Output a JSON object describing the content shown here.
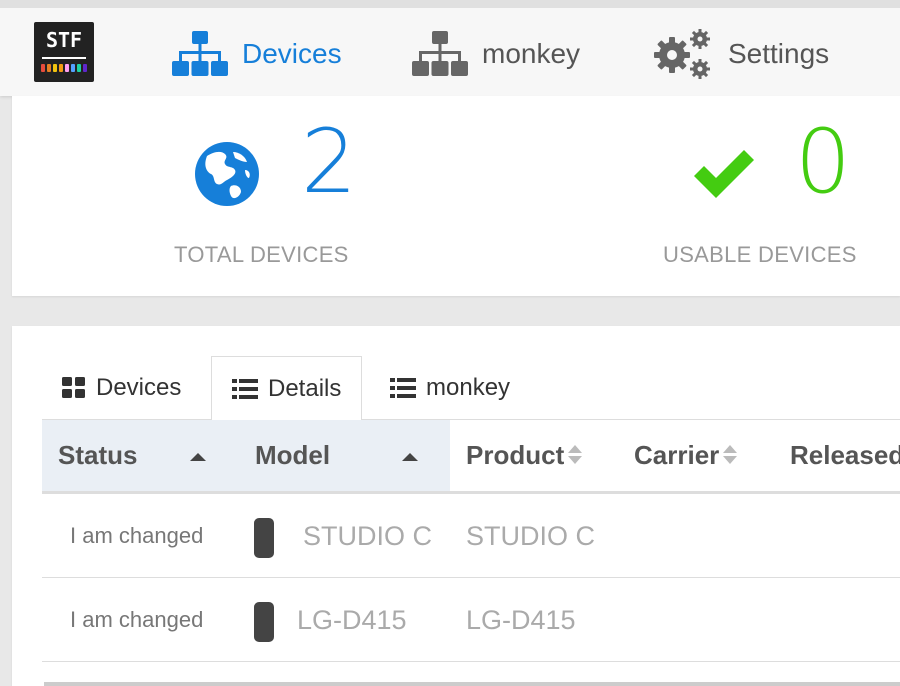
{
  "app": {
    "logo_text": "STF",
    "logo_key_colors": [
      "#e74c3c",
      "#e67e22",
      "#f1c40f",
      "#f39c12",
      "#ff9ff3",
      "#54a0ff",
      "#1dd1a1",
      "#5f27cd"
    ]
  },
  "nav": {
    "devices_label": "Devices",
    "monkey_label": "monkey",
    "settings_label": "Settings",
    "active": "Devices",
    "active_color": "#167fd9"
  },
  "stats": {
    "total": {
      "value": "2",
      "label": "TOTAL DEVICES",
      "color": "#167fd9",
      "icon": "globe-icon"
    },
    "usable": {
      "value": "0",
      "label": "USABLE DEVICES",
      "color": "#44cc11",
      "icon": "checkmark-icon"
    }
  },
  "tabs": [
    {
      "label": "Devices",
      "icon": "grid-icon",
      "active": false
    },
    {
      "label": "Details",
      "icon": "list-icon",
      "active": true
    },
    {
      "label": "monkey",
      "icon": "list-icon",
      "active": false
    }
  ],
  "table": {
    "columns": [
      {
        "label": "Status",
        "sort": "asc"
      },
      {
        "label": "Model",
        "sort": "asc"
      },
      {
        "label": "Product",
        "sort": "none"
      },
      {
        "label": "Carrier",
        "sort": "none"
      },
      {
        "label": "Released",
        "sort": "none"
      }
    ],
    "rows": [
      {
        "status": "I am changed",
        "model": "STUDIO C",
        "product": "STUDIO C"
      },
      {
        "status": "I am changed",
        "model": "LG-D415",
        "product": "LG-D415"
      }
    ]
  }
}
